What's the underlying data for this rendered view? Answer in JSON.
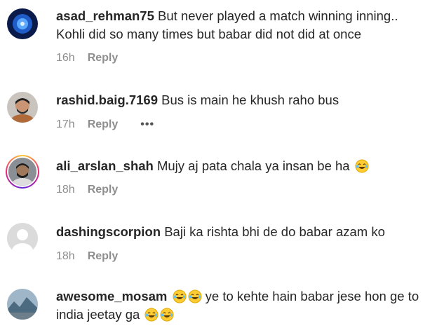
{
  "comments": [
    {
      "username": "asad_rehman75",
      "text": "But never played a match winning inning..",
      "text_line2": "Kohli did so many times but babar did not did at once",
      "time": "16h",
      "reply": "Reply"
    },
    {
      "username": "rashid.baig.7169",
      "text": "Bus is main he khush raho bus",
      "time": "17h",
      "reply": "Reply",
      "more": "•••"
    },
    {
      "username": "ali_arslan_shah",
      "text": "Mujy aj pata chala ya insan be ha",
      "emoji": "face-with-tears-of-joy",
      "time": "18h",
      "reply": "Reply"
    },
    {
      "username": "dashingscorpion",
      "text": "Baji ka rishta bhi de do babar azam ko",
      "time": "18h",
      "reply": "Reply"
    },
    {
      "username": "awesome_mosam",
      "emoji_prefix": [
        "face-with-tears-of-joy",
        "face-with-tears-of-joy"
      ],
      "text": "ye to kehte hain babar jese hon ge to",
      "text_line2": "india jeetay ga",
      "emoji_suffix": [
        "face-with-tears-of-joy",
        "face-with-tears-of-joy"
      ]
    }
  ],
  "colors": {
    "text": "#262626",
    "meta": "#8e8e8e",
    "ring": "#ee2a7b"
  }
}
